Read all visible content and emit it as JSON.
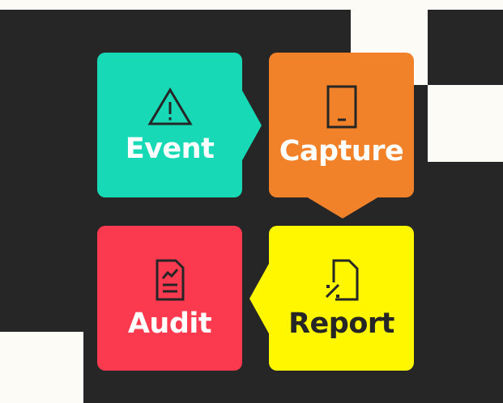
{
  "colors": {
    "background_light": "#fdfbf5",
    "background_dark": "#262626",
    "event": "#17d9b5",
    "capture": "#f2822a",
    "report": "#fff700",
    "audit": "#fc3a4f",
    "light_text": "#ffffff",
    "dark_text": "#262626"
  },
  "steps": [
    {
      "label": "Event",
      "icon": "warning-triangle-icon"
    },
    {
      "label": "Capture",
      "icon": "mobile-phone-icon"
    },
    {
      "label": "Report",
      "icon": "document-percent-icon"
    },
    {
      "label": "Audit",
      "icon": "clipboard-chart-icon"
    }
  ],
  "flow": [
    "Event",
    "Capture",
    "Report",
    "Audit"
  ]
}
